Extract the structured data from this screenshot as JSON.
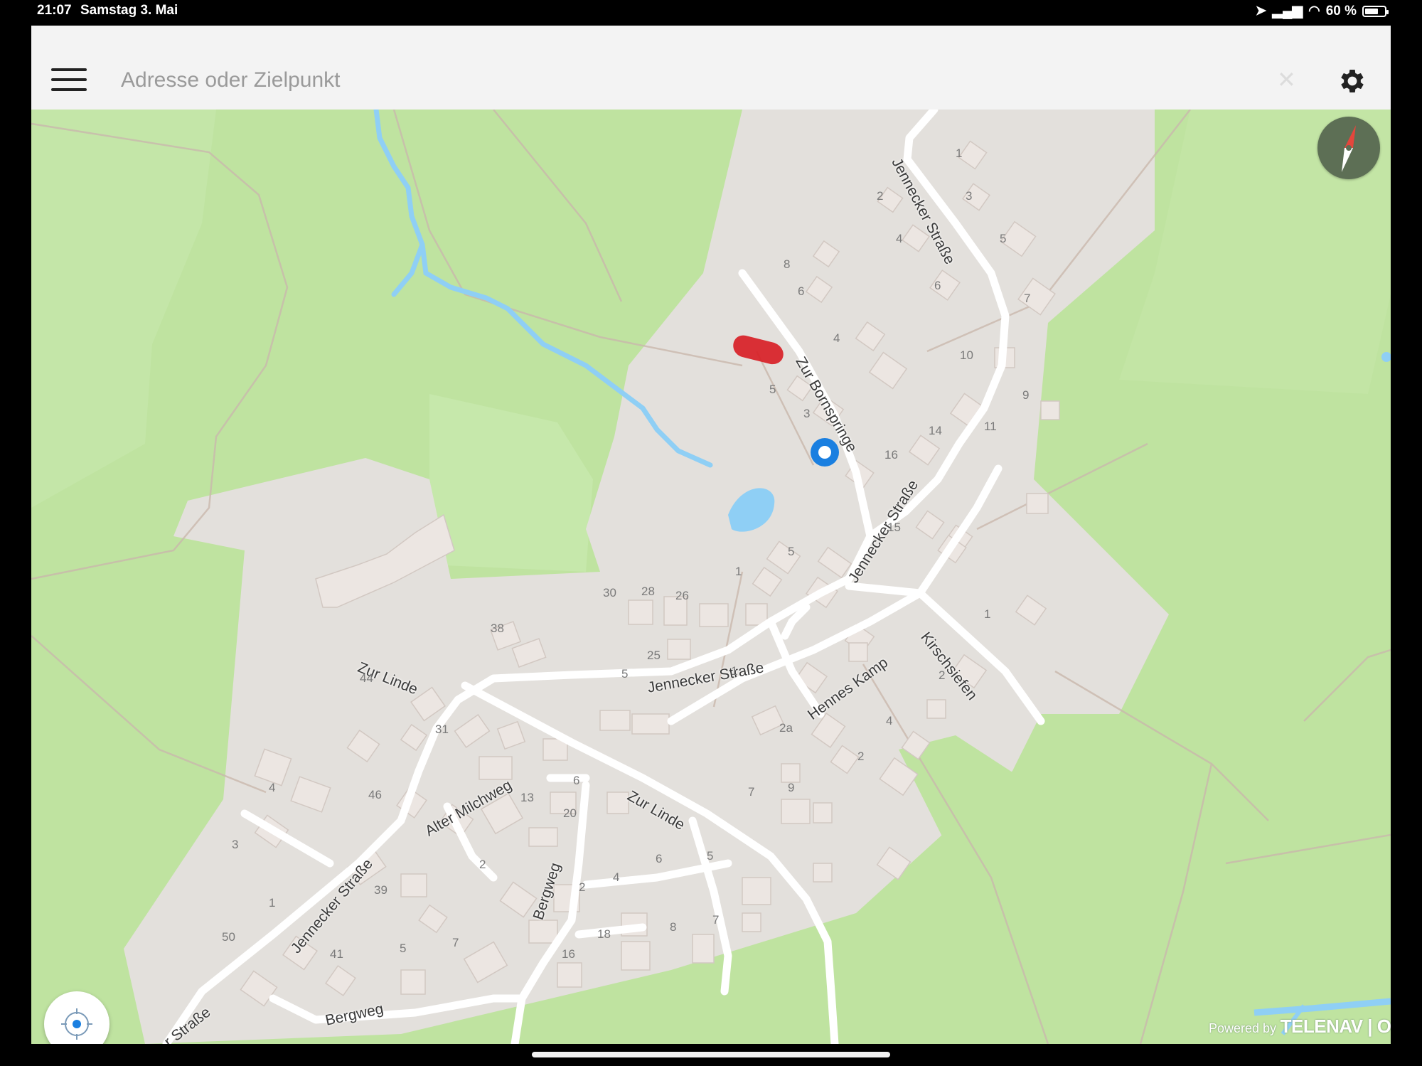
{
  "status_bar": {
    "time": "21:07",
    "date": "Samstag 3. Mai",
    "battery": "60 %",
    "battery_level": 0.6
  },
  "search": {
    "placeholder": "Adresse oder Zielpunkt"
  },
  "icons": {
    "menu": "hamburger-icon",
    "clear": "close-icon",
    "settings": "gear-icon",
    "compass": "compass-icon",
    "locate": "locate-icon"
  },
  "colors": {
    "forest": "#bfe3a0",
    "residential": "#e3e0dc",
    "road": "#ffffff",
    "water": "#8fcff5",
    "user_location": "#1a7fe0",
    "marker": "#d81f26"
  },
  "map": {
    "streets": [
      "Jennecker Straße",
      "Zur Bornspringe",
      "Jennecker Straße",
      "Jennecker Straße",
      "Zur Linde",
      "Hennes Kamp",
      "Kirschsiefen",
      "Alter Milchweg",
      "Zur Linde",
      "Jennecker Straße",
      "Bergweg",
      "Bergweg",
      "r Straße"
    ],
    "house_numbers": [
      "1",
      "3",
      "2",
      "4",
      "5",
      "8",
      "6",
      "6",
      "7",
      "4",
      "10",
      "9",
      "5",
      "3",
      "11",
      "14",
      "16",
      "15",
      "5",
      "1",
      "30",
      "28",
      "26",
      "38",
      "25",
      "5",
      "1",
      "2a",
      "44",
      "31",
      "4",
      "46",
      "6",
      "20",
      "13",
      "9",
      "7",
      "2",
      "3",
      "39",
      "1",
      "50",
      "41",
      "5",
      "7",
      "2",
      "2",
      "4",
      "6",
      "5",
      "18",
      "16",
      "8",
      "7",
      "1",
      "2",
      "4"
    ]
  },
  "attribution": {
    "prefix": "Powered by",
    "brand": "TELENAV | OSM"
  }
}
